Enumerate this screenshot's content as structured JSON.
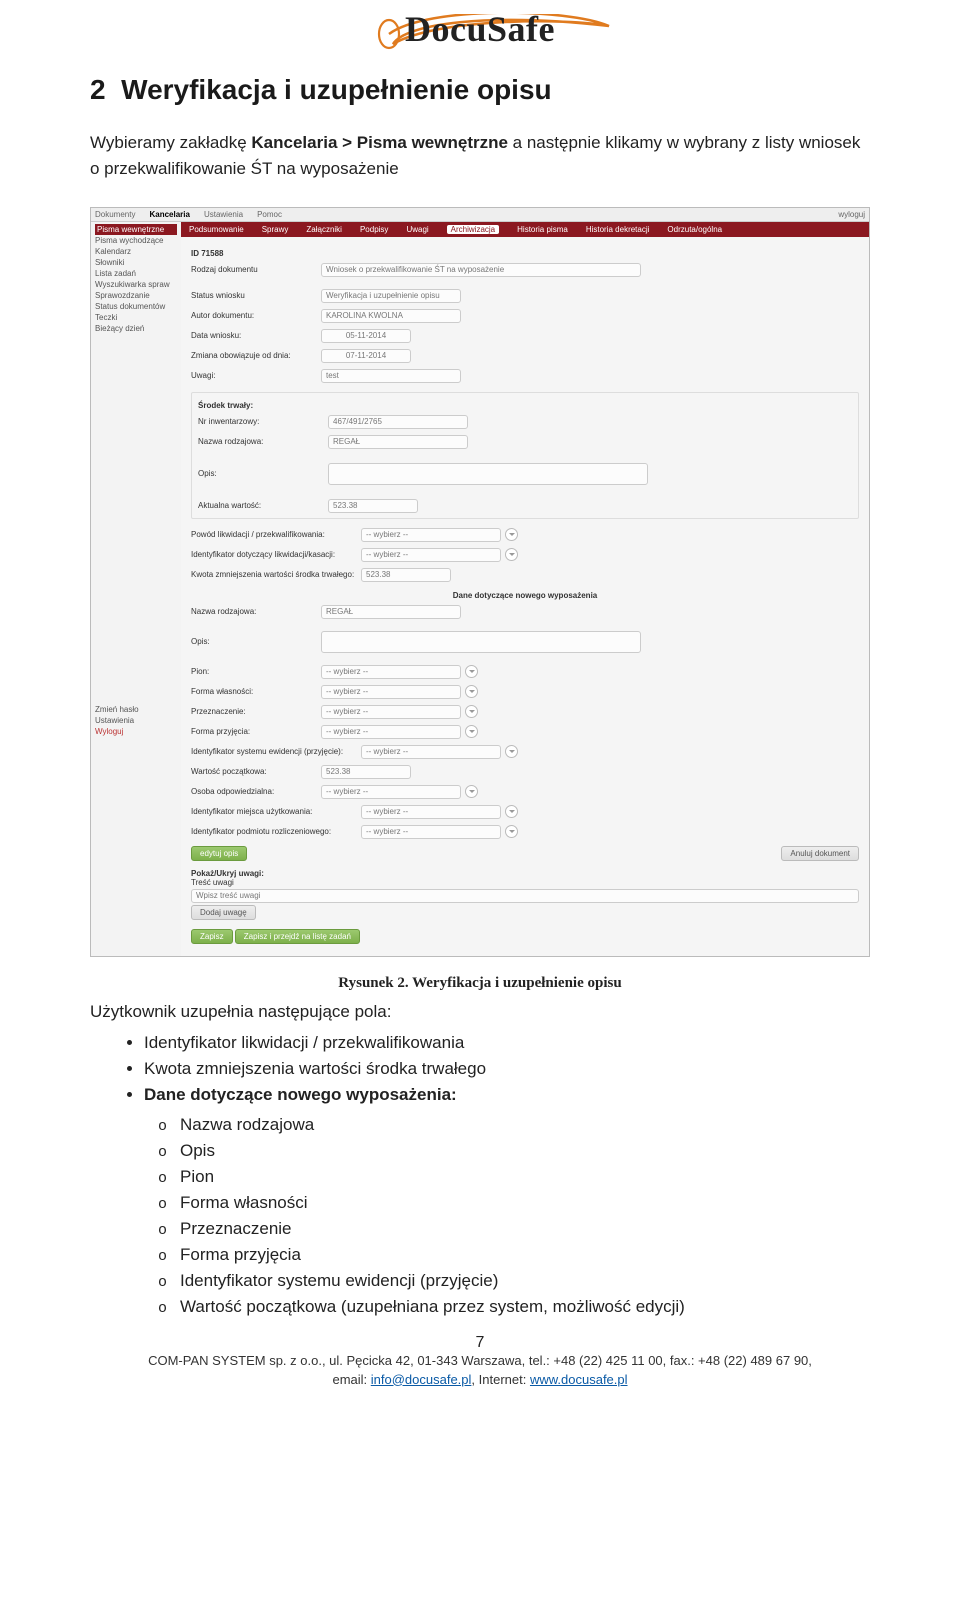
{
  "logo_text": "DocuSafe",
  "section_number": "2",
  "section_title": "Weryfikacja i uzupełnienie opisu",
  "lead_a": "Wybieramy zakładkę ",
  "lead_b": "Kancelaria > Pisma wewnętrzne",
  "lead_c": " a następnie klikamy w wybrany z listy wniosek o przekwalifikowanie ŚT na wyposażenie",
  "screenshot": {
    "tabs": {
      "a": "Dokumenty",
      "b": "Kancelaria",
      "c": "Ustawienia",
      "d": "Pomoc",
      "logout": "wyloguj"
    },
    "side": [
      "Pisma wewnętrzne",
      "Pisma wychodzące",
      "Kalendarz",
      "Słowniki",
      "Lista zadań",
      "Wyszukiwarka spraw",
      "Sprawozdzanie",
      "Status dokumentów",
      "Teczki",
      "Bieżący dzień"
    ],
    "ribbon": [
      "Podsumowanie",
      "Sprawy",
      "Załączniki",
      "Podpisy",
      "Uwagi",
      "Archiwizacja",
      "Historia pisma",
      "Historia dekretacji",
      "Odrzuta/ogólna"
    ],
    "id": "ID 71588",
    "rows": {
      "rodzaj": "Rodzaj dokumentu",
      "rodzaj_val": "Wniosek o przekwalifikowanie ŚT na wyposażenie",
      "status": "Status wniosku",
      "status_val": "Weryfikacja i uzupełnienie opisu",
      "autor": "Autor dokumentu:",
      "autor_val": "KAROLINA KWOLNA",
      "data": "Data wniosku:",
      "data_val": "05-11-2014",
      "zmiana": "Zmiana obowiązuje od dnia:",
      "zmiana_val": "07-11-2014",
      "uwagi": "Uwagi:",
      "uwagi_val": "test",
      "srodek_h": "Środek trwały:",
      "nr_inw": "Nr inwentarzowy:",
      "nr_inw_val": "467/491/2765",
      "nazwa": "Nazwa rodzajowa:",
      "nazwa_val": "REGAŁ",
      "opis": "Opis:",
      "aktualna": "Aktualna wartość:",
      "aktualna_val": "523.38",
      "pow": "Powód likwidacji / przekwalifikowania:",
      "pow_val": "-- wybierz --",
      "idlik": "Identyfikator dotyczący likwidacji/kasacji:",
      "idlik_val": "-- wybierz --",
      "kwota": "Kwota zmniejszenia wartości środka trwałego:",
      "kwota_val": "523.38",
      "dane_h": "Dane dotyczące nowego wyposażenia",
      "naz2": "Nazwa rodzajowa:",
      "naz2_val": "REGAŁ",
      "opis2": "Opis:",
      "pion": "Pion:",
      "forma_w": "Forma własności:",
      "przez": "Przeznaczenie:",
      "forma_p": "Forma przyjęcia:",
      "ident_sys": "Identyfikator systemu ewidencji (przyjęcie):",
      "wart_p": "Wartość początkowa:",
      "wart_p_val": "523.38",
      "osoba": "Osoba odpowiedzialna:",
      "miejsce": "Identyfikator miejsca użytkowania:",
      "podmiot": "Identyfikator podmiotu rozliczeniowego:",
      "wybierz": "-- wybierz --",
      "btn_edit": "edytuj opis",
      "btn_anuluj": "Anuluj dokument",
      "pokaz": "Pokaż/Ukryj uwagi:",
      "tresc": "Treść uwagi",
      "wpisz": "Wpisz treść uwagi",
      "dodaj": "Dodaj uwagę",
      "zapisz": "Zapisz",
      "zapisz2": "Zapisz i przejdź na listę zadań",
      "bottom_links": [
        "Zmień hasło",
        "Ustawienia",
        "Wyloguj"
      ]
    }
  },
  "caption": "Rysunek 2. Weryfikacja i uzupełnienie opisu",
  "body_line": "Użytkownik uzupełnia następujące pola:",
  "bullets": {
    "b1": "Identyfikator likwidacji / przekwalifikowania",
    "b2": "Kwota zmniejszenia wartości środka trwałego",
    "b3": "Dane dotyczące nowego wyposażenia:",
    "s1": "Nazwa rodzajowa",
    "s2": "Opis",
    "s3": "Pion",
    "s4": "Forma własności",
    "s5": "Przeznaczenie",
    "s6": "Forma przyjęcia",
    "s7": "Identyfikator systemu ewidencji (przyjęcie)",
    "s8": "Wartość początkowa (uzupełniana przez system, możliwość edycji)"
  },
  "page_num": "7",
  "footer": {
    "l1a": "COM-PAN SYSTEM sp. z o.o., ul. Pęcicka 42, 01-343 Warszawa, tel.: +48 (22) 425 11 00, fax.: +48 (22) 489 67 90,",
    "l2a": "email: ",
    "mail": "info@docusafe.pl",
    "l2b": ", Internet: ",
    "site": "www.docusafe.pl"
  }
}
